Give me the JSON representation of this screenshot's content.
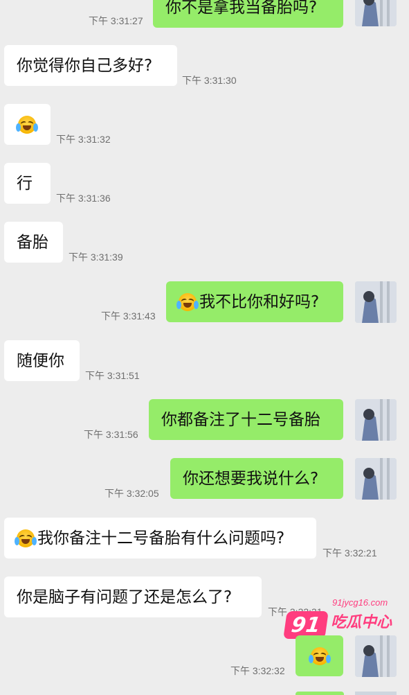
{
  "messages": [
    {
      "id": "m1",
      "side": "right",
      "text": "你不是拿我当备胎吗?",
      "time": "下午 3:31:27",
      "emoji": false
    },
    {
      "id": "m2",
      "side": "left",
      "text": "你觉得你自己多好?",
      "time": "下午 3:31:30",
      "emoji": false
    },
    {
      "id": "m3",
      "side": "left",
      "text": "",
      "time": "下午 3:31:32",
      "emoji": true,
      "emoji_name": "tears-of-joy-icon"
    },
    {
      "id": "m4",
      "side": "left",
      "text": "行",
      "time": "下午 3:31:36",
      "emoji": false
    },
    {
      "id": "m5",
      "side": "left",
      "text": "备胎",
      "time": "下午 3:31:39",
      "emoji": false
    },
    {
      "id": "m6",
      "side": "right",
      "text": "我不比你和好吗?",
      "time": "下午 3:31:43",
      "emoji": true,
      "emoji_name": "tears-of-joy-icon"
    },
    {
      "id": "m7",
      "side": "left",
      "text": "随便你",
      "time": "下午 3:31:51",
      "emoji": false
    },
    {
      "id": "m8",
      "side": "right",
      "text": "你都备注了十二号备胎",
      "time": "下午 3:31:56",
      "emoji": false
    },
    {
      "id": "m9",
      "side": "right",
      "text": "你还想要我说什么?",
      "time": "下午 3:32:05",
      "emoji": false
    },
    {
      "id": "m10",
      "side": "left",
      "text": "我你备注十二号备胎有什么问题吗?",
      "time": "下午 3:32:21",
      "emoji": true,
      "emoji_name": "tears-of-joy-icon"
    },
    {
      "id": "m11",
      "side": "left",
      "text": "你是脑子有问题了还是怎么了?",
      "time": "下午 3:32:31",
      "emoji": false
    },
    {
      "id": "m12",
      "side": "right",
      "text": "",
      "time": "下午 3:32:32",
      "emoji": true,
      "emoji_name": "tears-of-joy-icon"
    }
  ],
  "watermark": {
    "badge": "91",
    "url": "91jycg16.com",
    "text": "吃瓜中心"
  },
  "colors": {
    "background": "#ededed",
    "left_bubble": "#ffffff",
    "right_bubble": "#95ec69",
    "timestamp": "#6e6e6e",
    "watermark": "#ff3d7f"
  }
}
